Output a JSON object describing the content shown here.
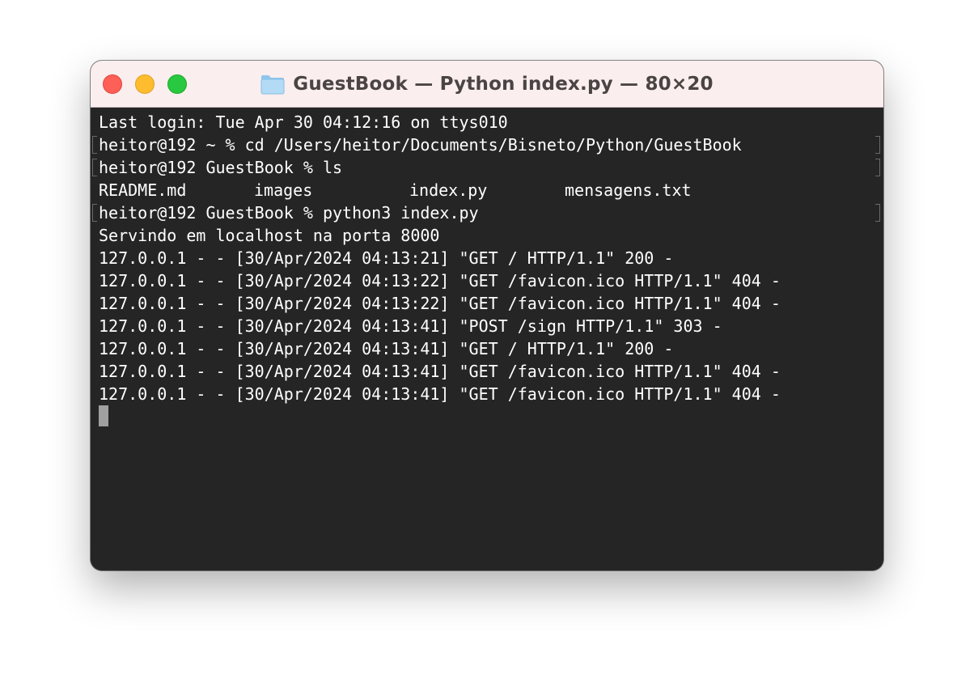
{
  "window": {
    "title": "GuestBook — Python index.py — 80×20",
    "title_icon": "folder-icon"
  },
  "colors": {
    "terminal_bg": "#252525",
    "terminal_text": "#ffffff",
    "titlebar_bg": "#fbeeee",
    "close": "#fe5f57",
    "minimize": "#febc2e",
    "maximize": "#28c840"
  },
  "terminal": {
    "lines": [
      "Last login: Tue Apr 30 04:12:16 on ttys010",
      "heitor@192 ~ % cd /Users/heitor/Documents/Bisneto/Python/GuestBook",
      "heitor@192 GuestBook % ls",
      "",
      "heitor@192 GuestBook % python3 index.py",
      "Servindo em localhost na porta 8000",
      "127.0.0.1 - - [30/Apr/2024 04:13:21] \"GET / HTTP/1.1\" 200 -",
      "127.0.0.1 - - [30/Apr/2024 04:13:22] \"GET /favicon.ico HTTP/1.1\" 404 -",
      "127.0.0.1 - - [30/Apr/2024 04:13:22] \"GET /favicon.ico HTTP/1.1\" 404 -",
      "127.0.0.1 - - [30/Apr/2024 04:13:41] \"POST /sign HTTP/1.1\" 303 -",
      "127.0.0.1 - - [30/Apr/2024 04:13:41] \"GET / HTTP/1.1\" 200 -",
      "127.0.0.1 - - [30/Apr/2024 04:13:41] \"GET /favicon.ico HTTP/1.1\" 404 -",
      "127.0.0.1 - - [30/Apr/2024 04:13:41] \"GET /favicon.ico HTTP/1.1\" 404 -"
    ],
    "ls_output": [
      "README.md",
      "images",
      "index.py",
      "mensagens.txt"
    ]
  }
}
